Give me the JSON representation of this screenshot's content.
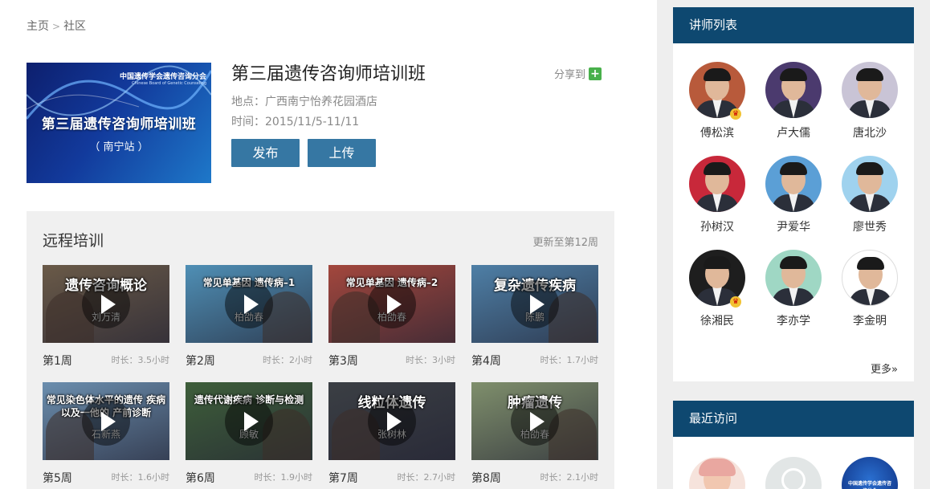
{
  "breadcrumb": {
    "home": "主页",
    "sep": ">",
    "current": "社区"
  },
  "course": {
    "cover_org": "中国遗传学会遗传咨询分会",
    "cover_org_en": "Chinese Board of Genetic Counseling",
    "cover_title": "第三届遗传咨询师培训班",
    "cover_subtitle": "（ 南宁站 ）",
    "title": "第三届遗传咨询师培训班",
    "location": "地点：广西南宁怡养花园酒店",
    "time": "时间：2015/11/5-11/11",
    "share_label": "分享到",
    "publish_label": "发布",
    "upload_label": "上传"
  },
  "training": {
    "title": "远程培训",
    "update": "更新至第12周",
    "videos": [
      {
        "caption": "遗传咨询概论",
        "speaker": "刘万清",
        "week": "第1周",
        "duration": "时长：3.5小时",
        "bg": "#6a5a48"
      },
      {
        "caption": "常见单基因 遗传病–1",
        "speaker": "柏劭春",
        "week": "第2周",
        "duration": "时长：2小时",
        "bg": "#4f8fb5"
      },
      {
        "caption": "常见单基因 遗传病–2",
        "speaker": "柏劭春",
        "week": "第3周",
        "duration": "时长：3小时",
        "bg": "#a3473d"
      },
      {
        "caption": "复杂遗传疾病",
        "speaker": "陈鹏",
        "week": "第4周",
        "duration": "时长：1.7小时",
        "bg": "#4e7fa6"
      },
      {
        "caption": "常见染色体水平的遗传 疾病以及一他的 产前诊断",
        "speaker": "石新燕",
        "week": "第5周",
        "duration": "时长：1.6小时",
        "bg": "#6b8eae"
      },
      {
        "caption": "遗传代谢疾病 诊断与检测",
        "speaker": "顾敏",
        "week": "第6周",
        "duration": "时长：1.9小时",
        "bg": "#3e5e3a"
      },
      {
        "caption": "线粒体遗传",
        "speaker": "张树林",
        "week": "第7周",
        "duration": "时长：2.7小时",
        "bg": "#3b3f44"
      },
      {
        "caption": "肿瘤遗传",
        "speaker": "柏劭春",
        "week": "第8周",
        "duration": "时长：2.1小时",
        "bg": "#7f8f6c"
      }
    ]
  },
  "teachers": {
    "title": "讲师列表",
    "more": "更多»",
    "items": [
      {
        "name": "傅松滨",
        "bg": "#b85a3b",
        "crown": true
      },
      {
        "name": "卢大儒",
        "bg": "#4b3a6e",
        "crown": false
      },
      {
        "name": "唐北沙",
        "bg": "#c9c4d6",
        "crown": false
      },
      {
        "name": "孙树汉",
        "bg": "#c8283a",
        "crown": false
      },
      {
        "name": "尹爱华",
        "bg": "#5b9fd6",
        "crown": false
      },
      {
        "name": "廖世秀",
        "bg": "#9fd2ee",
        "crown": false
      },
      {
        "name": "徐湘民",
        "bg": "#1e1e1e",
        "crown": true
      },
      {
        "name": "李亦学",
        "bg": "#9fd7c4",
        "crown": false
      },
      {
        "name": "李金明",
        "bg": "#ffffff",
        "crown": false
      }
    ]
  },
  "recent": {
    "title": "最近访问"
  }
}
